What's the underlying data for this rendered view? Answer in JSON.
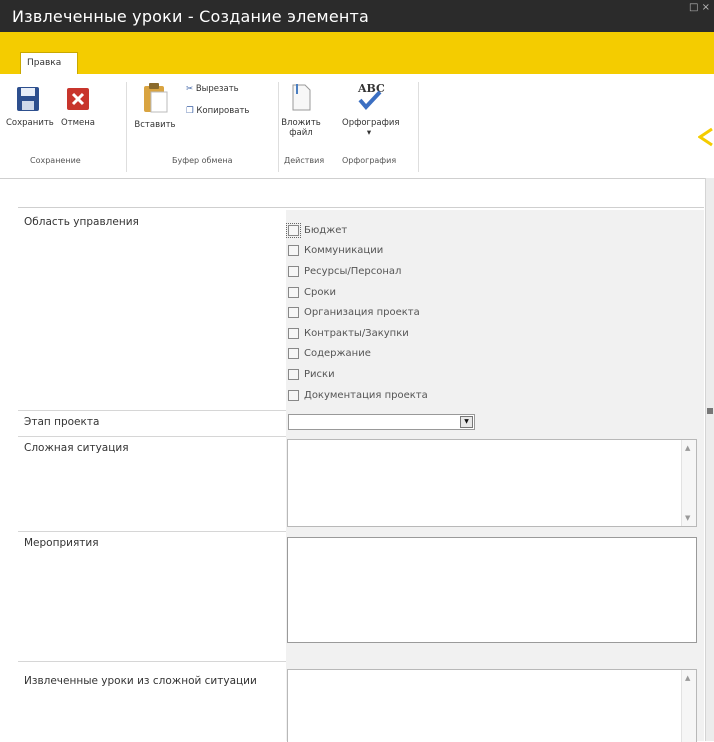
{
  "window": {
    "title": "Извлеченные уроки - Создание элемента",
    "controls": "□ ×"
  },
  "ribbon": {
    "tab_label": "Правка",
    "save_label": "Сохранить",
    "cancel_label": "Отмена",
    "paste_label": "Вставить",
    "cut_label": "Вырезать",
    "copy_label": "Копировать",
    "attach_label_1": "Вложить",
    "attach_label_2": "файл",
    "spelling_label": "Орфография",
    "spelling_arrow": "▾",
    "groups": {
      "save": "Сохранение",
      "clipboard": "Буфер обмена",
      "actions": "Действия",
      "spelling": "Орфография"
    },
    "colors": {
      "accent_yellow": "#f4cc00",
      "title_dark": "#2b2b2b"
    }
  },
  "form": {
    "area_label": "Область управления",
    "area_options": [
      "Бюджет",
      "Коммуникации",
      "Ресурсы/Персонал",
      "Сроки",
      "Организация проекта",
      "Контракты/Закупки",
      "Содержание",
      "Риски",
      "Документация проекта"
    ],
    "stage_label": "Этап проекта",
    "stage_value": "",
    "situation_label": "Сложная ситуация",
    "situation_value": "",
    "measures_label": "Мероприятия",
    "measures_value": "",
    "lessons_label": "Извлеченные уроки из сложной ситуации",
    "lessons_value": ""
  }
}
